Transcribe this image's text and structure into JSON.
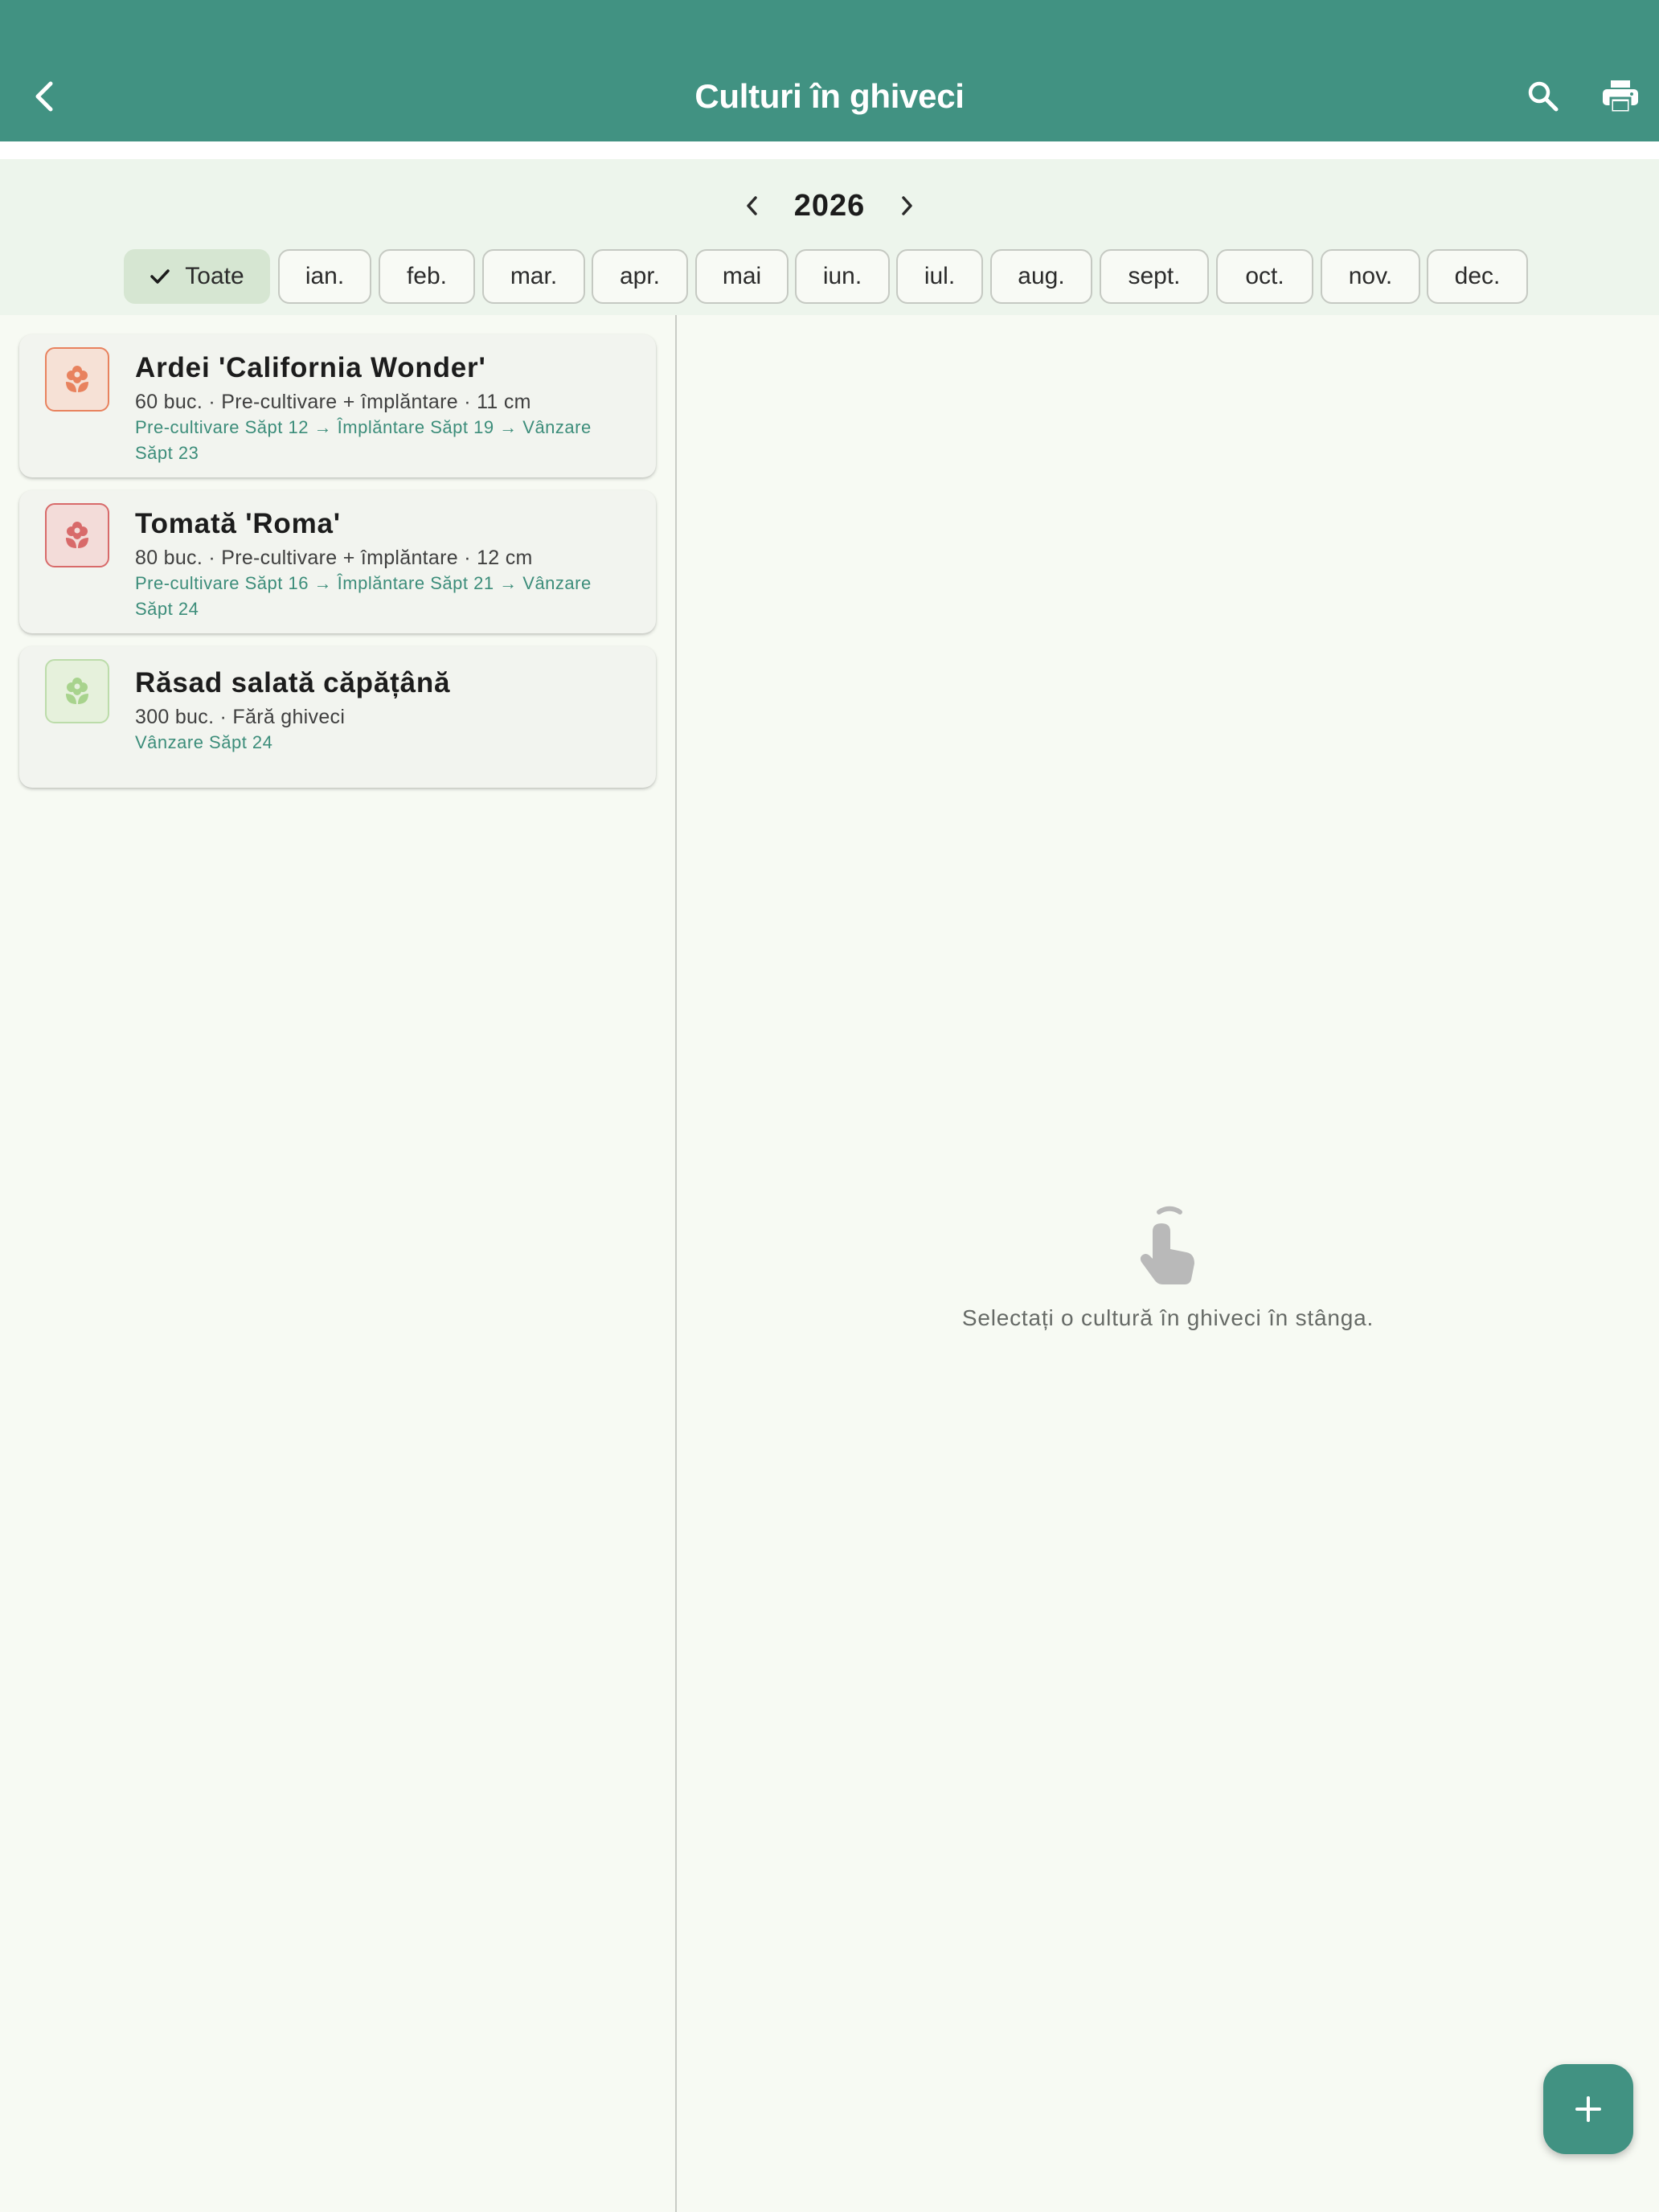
{
  "appbar": {
    "title": "Culturi în ghiveci",
    "back_icon": "chevron-left-icon",
    "search_icon": "search-icon",
    "print_icon": "print-icon",
    "color": "#419282"
  },
  "filter": {
    "year": "2026",
    "months": [
      {
        "label": "Toate",
        "selected": true
      },
      {
        "label": "ian.",
        "selected": false
      },
      {
        "label": "feb.",
        "selected": false
      },
      {
        "label": "mar.",
        "selected": false
      },
      {
        "label": "apr.",
        "selected": false
      },
      {
        "label": "mai",
        "selected": false
      },
      {
        "label": "iun.",
        "selected": false
      },
      {
        "label": "iul.",
        "selected": false
      },
      {
        "label": "aug.",
        "selected": false
      },
      {
        "label": "sept.",
        "selected": false
      },
      {
        "label": "oct.",
        "selected": false
      },
      {
        "label": "nov.",
        "selected": false
      },
      {
        "label": "dec.",
        "selected": false
      }
    ]
  },
  "crops": [
    {
      "name": "Ardei 'California Wonder'",
      "meta": "60 buc. · Pre-cultivare + împlăntare · 11 cm",
      "schedule": "Pre-cultivare Săpt 12 → Împlăntare Săpt 19 → Vânzare Săpt 23",
      "icon": "flower-icon",
      "accent": "#e8825e",
      "tint": "#f6e1d6"
    },
    {
      "name": "Tomată 'Roma'",
      "meta": "80 buc. · Pre-cultivare + împlăntare · 12 cm",
      "schedule": "Pre-cultivare Săpt 16 → Împlăntare Săpt 21 → Vânzare Săpt 24",
      "icon": "flower-icon",
      "accent": "#d86a6a",
      "tint": "#f3dcd9"
    },
    {
      "name": "Răsad salată căpățână",
      "meta": "300 buc. · Fără ghiveci",
      "schedule": "Vânzare Săpt 24",
      "icon": "flower-icon",
      "accent": "#a8d38d",
      "tint": "#e6f1dc"
    }
  ],
  "detail": {
    "empty_icon": "touch-icon",
    "empty_text": "Selectați o cultură în ghiveci în stânga."
  },
  "fab": {
    "icon": "plus-icon"
  }
}
